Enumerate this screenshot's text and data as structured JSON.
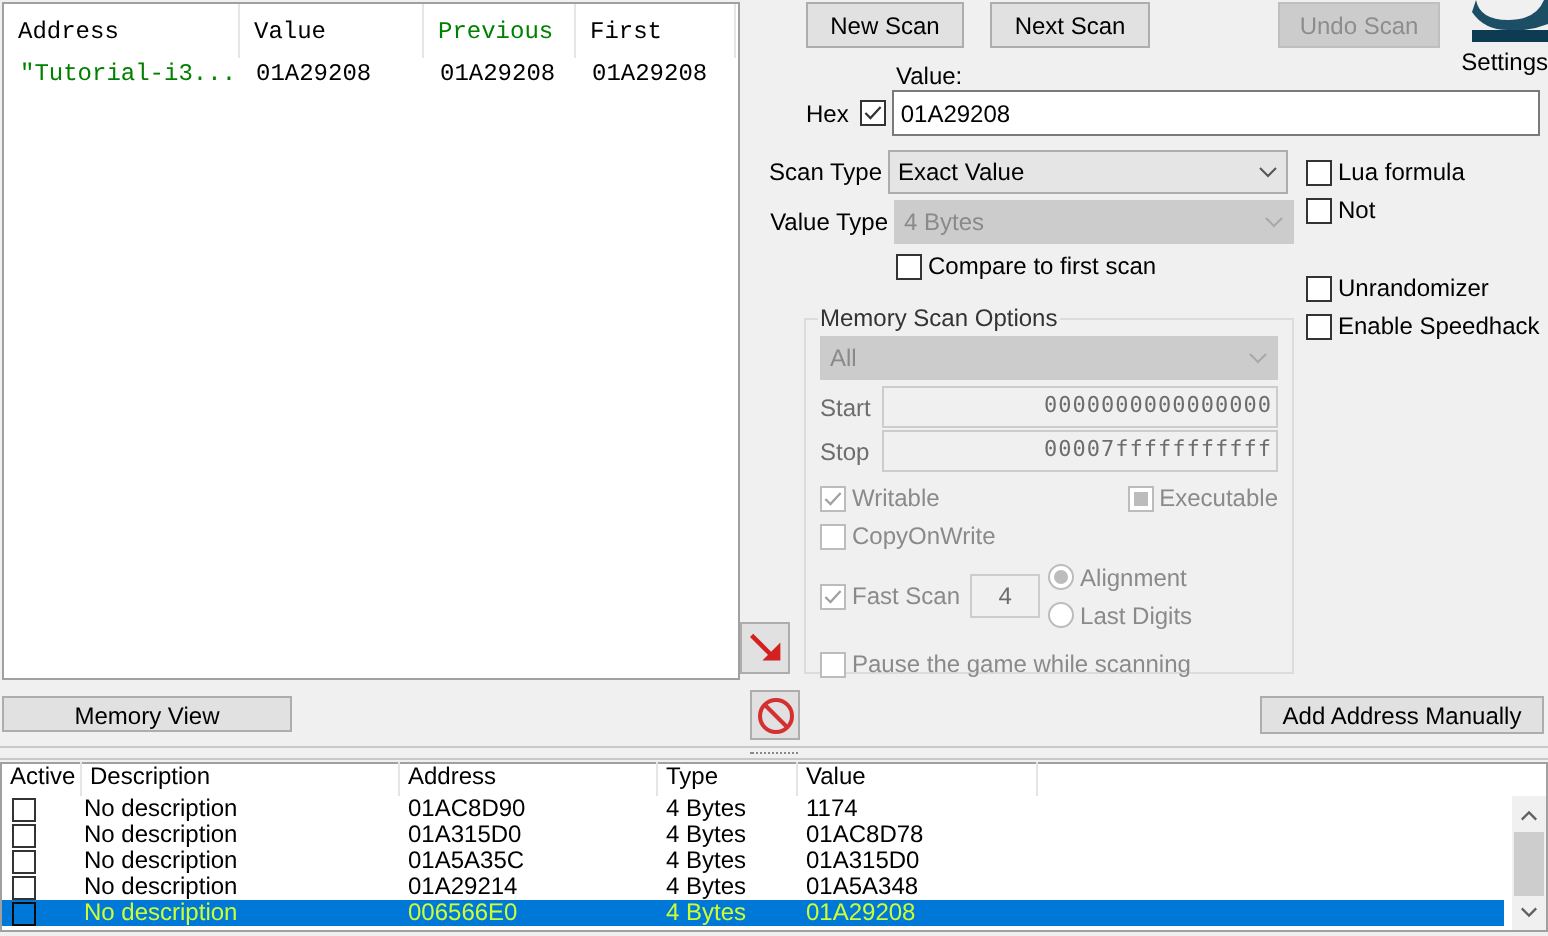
{
  "results": {
    "columns": [
      {
        "label": "Address",
        "color": "#000000"
      },
      {
        "label": "Value",
        "color": "#000000"
      },
      {
        "label": "Previous",
        "color": "#008000"
      },
      {
        "label": "First",
        "color": "#000000"
      }
    ],
    "rows": [
      {
        "cells": [
          {
            "text": "\"Tutorial-i3...",
            "color": "#008000"
          },
          {
            "text": "01A29208",
            "color": "#000000"
          },
          {
            "text": "01A29208",
            "color": "#000000"
          },
          {
            "text": "01A29208",
            "color": "#000000"
          }
        ]
      }
    ]
  },
  "scan_buttons": [
    {
      "label": "New Scan",
      "disabled": false
    },
    {
      "label": "Next Scan",
      "disabled": false
    },
    {
      "label": "Undo Scan",
      "disabled": true
    }
  ],
  "settings_label": "Settings",
  "value": {
    "label": "Value:",
    "hex_label": "Hex",
    "hex_checked": true,
    "text": "01A29208"
  },
  "scan_type": {
    "label": "Scan Type",
    "value": "Exact Value",
    "disabled": false
  },
  "value_type": {
    "label": "Value Type",
    "value": "4 Bytes",
    "disabled": true
  },
  "compare_first": {
    "label": "Compare to first scan",
    "checked": false
  },
  "side_options": [
    {
      "label": "Lua formula",
      "checked": false
    },
    {
      "label": "Not",
      "checked": false
    },
    {
      "label": "Unrandomizer",
      "checked": false
    },
    {
      "label": "Enable Speedhack",
      "checked": false
    }
  ],
  "memory_scan_options": {
    "title": "Memory Scan Options",
    "region": "All",
    "start_label": "Start",
    "start": "0000000000000000",
    "stop_label": "Stop",
    "stop": "00007fffffffffff",
    "writable": {
      "label": "Writable",
      "checked": true
    },
    "executable": {
      "label": "Executable",
      "checked": false,
      "indeterminate": true
    },
    "copy_on_write": {
      "label": "CopyOnWrite",
      "checked": false
    },
    "fast_scan": {
      "label": "Fast Scan",
      "checked": true,
      "value": "4"
    },
    "fast_scan_modes": [
      {
        "label": "Alignment",
        "selected": true
      },
      {
        "label": "Last Digits",
        "selected": false
      }
    ],
    "pause": {
      "label": "Pause the game while scanning",
      "checked": false
    }
  },
  "memory_view_button": "Memory View",
  "add_address_button": "Add Address Manually",
  "address_list": {
    "columns": [
      "Active",
      "Description",
      "Address",
      "Type",
      "Value"
    ],
    "rows": [
      {
        "active": false,
        "selected": false,
        "description": "No description",
        "address": "01AC8D90",
        "type": "4 Bytes",
        "value": "1174"
      },
      {
        "active": false,
        "selected": false,
        "description": "No description",
        "address": "01A315D0",
        "type": "4 Bytes",
        "value": "01AC8D78"
      },
      {
        "active": false,
        "selected": false,
        "description": "No description",
        "address": "01A5A35C",
        "type": "4 Bytes",
        "value": "01A315D0"
      },
      {
        "active": false,
        "selected": false,
        "description": "No description",
        "address": "01A29214",
        "type": "4 Bytes",
        "value": "01A5A348"
      },
      {
        "active": false,
        "selected": true,
        "description": "No description",
        "address": "006566E0",
        "type": "4 Bytes",
        "value": "01A29208"
      }
    ]
  }
}
